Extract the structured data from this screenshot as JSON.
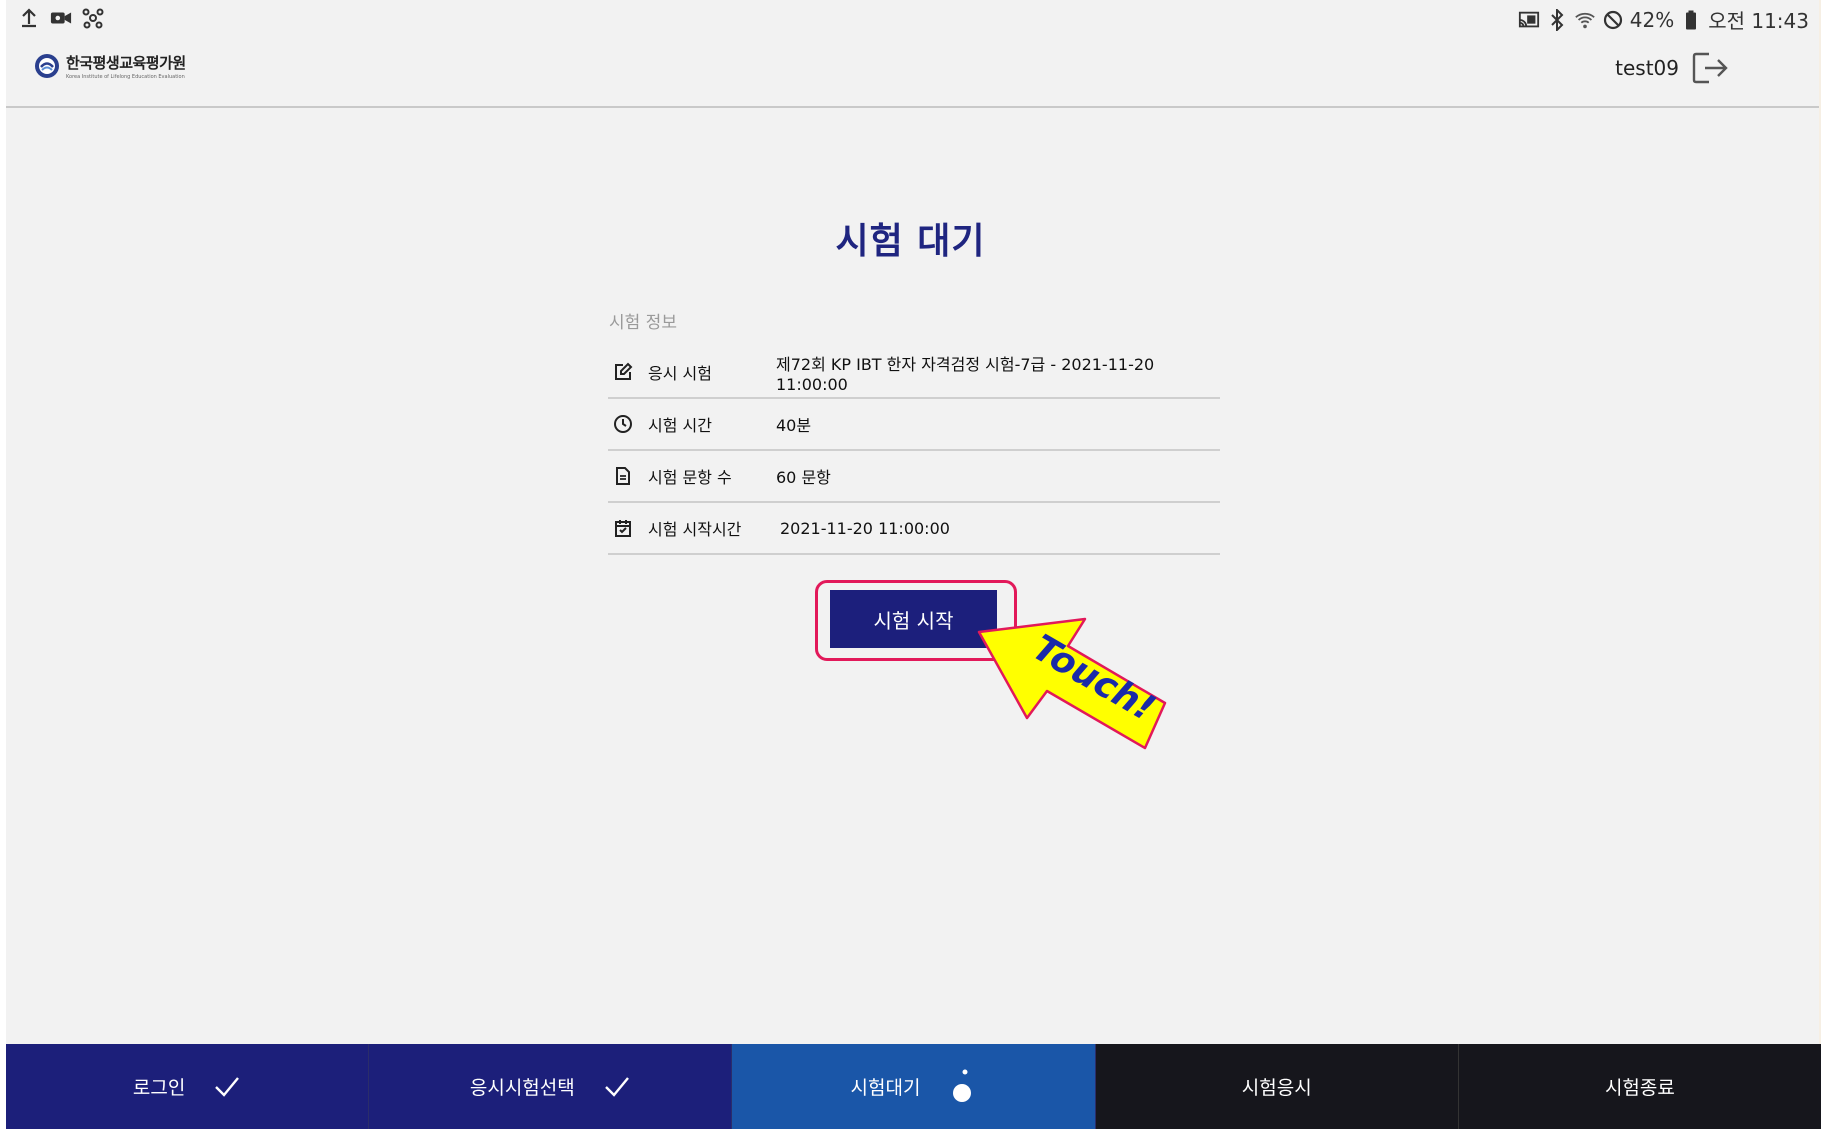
{
  "status_bar": {
    "left_icons": [
      "upload-icon",
      "video-icon",
      "network-icon"
    ],
    "right_icons": [
      "cast-icon",
      "bluetooth-icon",
      "wifi-icon",
      "do-not-disturb-icon",
      "battery-icon"
    ],
    "battery_text": "42%",
    "time_text": "오전 11:43"
  },
  "header": {
    "logo_name": "한국평생교육평가원",
    "logo_sub": "Korea Institute of Lifelong Education Evaluation",
    "username": "test09"
  },
  "main": {
    "title": "시험 대기",
    "section_label": "시험 정보",
    "rows": [
      {
        "icon": "edit-icon",
        "label": "응시 시험",
        "value": "제72회 KP IBT 한자 자격검정 시험-7급 - 2021-11-20 11:00:00"
      },
      {
        "icon": "clock-icon",
        "label": "시험 시간",
        "value": "40분"
      },
      {
        "icon": "document-icon",
        "label": "시험 문항 수",
        "value": "60 문항"
      },
      {
        "icon": "calendar-check-icon",
        "label": "시험 시작시간",
        "value": "2021-11-20 11:00:00"
      }
    ],
    "start_button_label": "시험 시작",
    "callout_text": "Touch!"
  },
  "steps": [
    {
      "label": "로그인",
      "state": "done"
    },
    {
      "label": "응시시험선택",
      "state": "done"
    },
    {
      "label": "시험대기",
      "state": "current"
    },
    {
      "label": "시험응시",
      "state": "todo"
    },
    {
      "label": "시험종료",
      "state": "todo"
    }
  ],
  "colors": {
    "accent_navy": "#1c1f7c",
    "step_current": "#1a56a8",
    "highlight_border": "#e2195a",
    "callout_fill": "#ffff00",
    "callout_text": "#1a2aa8"
  }
}
